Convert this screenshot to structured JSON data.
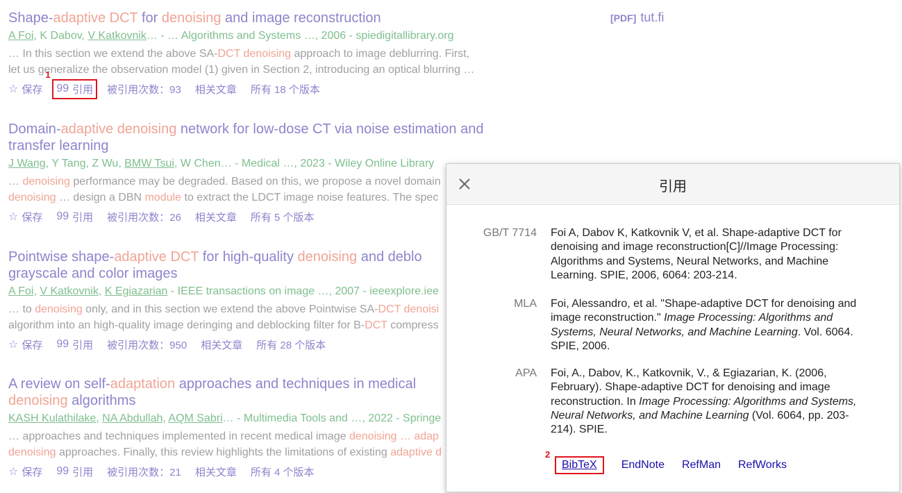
{
  "results": [
    {
      "title_parts": [
        [
          "Shape-",
          false
        ],
        [
          "adaptive DCT",
          true
        ],
        [
          " for ",
          false
        ],
        [
          "denoising",
          true
        ],
        [
          " and image reconstruction",
          false
        ]
      ],
      "authors": [
        [
          "A Foi",
          true
        ],
        [
          ", ",
          false
        ],
        [
          "K Dabov",
          false
        ],
        [
          ", ",
          false
        ],
        [
          "V Katkovnik",
          true
        ],
        [
          "… - … Algorithms and Systems …, 2006 - spiedigitallibrary.org",
          false
        ]
      ],
      "snippet_lines": [
        [
          [
            "… In this section we extend the above SA-",
            false
          ],
          [
            "DCT denoising",
            true
          ],
          [
            " approach to image deblurring. First,",
            false
          ]
        ],
        [
          [
            "let us generalize the observation model (1) given in Section 2, introducing an optical blurring …",
            false
          ]
        ]
      ],
      "actions": {
        "save": "保存",
        "cite": "引用",
        "cited_by": "被引用次数：93",
        "related": "相关文章",
        "versions": "所有 18 个版本"
      }
    },
    {
      "title_parts": [
        [
          "Domain‐",
          false
        ],
        [
          "adaptive denoising",
          true
        ],
        [
          " network for low‐dose CT via noise estimation and",
          false
        ]
      ],
      "title_line2": [
        [
          "transfer learning",
          false
        ]
      ],
      "authors": [
        [
          "J Wang",
          true
        ],
        [
          ", ",
          false
        ],
        [
          "Y Tang",
          false
        ],
        [
          ", ",
          false
        ],
        [
          "Z Wu",
          false
        ],
        [
          ", ",
          false
        ],
        [
          "BMW Tsui",
          true
        ],
        [
          ", ",
          false
        ],
        [
          "W Chen",
          false
        ],
        [
          "… - Medical …, 2023 - Wiley Online Library",
          false
        ]
      ],
      "snippet_lines": [
        [
          [
            "… ",
            false
          ],
          [
            "denoising",
            true
          ],
          [
            " performance may be degraded. Based on this, we propose a novel domain",
            false
          ]
        ],
        [
          [
            "denoising",
            true
          ],
          [
            " … design a DBN ",
            false
          ],
          [
            "module",
            true
          ],
          [
            " to extract the LDCT image noise features. The spec",
            false
          ]
        ]
      ],
      "actions": {
        "save": "保存",
        "cite": "引用",
        "cited_by": "被引用次数：26",
        "related": "相关文章",
        "versions": "所有 5 个版本"
      }
    },
    {
      "title_parts": [
        [
          "Pointwise shape-",
          false
        ],
        [
          "adaptive DCT",
          true
        ],
        [
          " for high-quality ",
          false
        ],
        [
          "denoising",
          true
        ],
        [
          " and deblo",
          false
        ]
      ],
      "title_line2": [
        [
          "grayscale and color images",
          false
        ]
      ],
      "authors": [
        [
          "A Foi",
          true
        ],
        [
          ", ",
          false
        ],
        [
          "V Katkovnik",
          true
        ],
        [
          ", ",
          false
        ],
        [
          "K Egiazarian",
          true
        ],
        [
          " - IEEE transactions on image …, 2007 - ieeexplore.iee",
          false
        ]
      ],
      "snippet_lines": [
        [
          [
            "… to ",
            false
          ],
          [
            "denoising",
            true
          ],
          [
            " only, and in this section we extend the above Pointwise SA-",
            false
          ],
          [
            "DCT denoisi",
            true
          ]
        ],
        [
          [
            "algorithm into an high-quality image deringing and deblocking filter for B-",
            false
          ],
          [
            "DCT",
            true
          ],
          [
            " compress",
            false
          ]
        ]
      ],
      "actions": {
        "save": "保存",
        "cite": "引用",
        "cited_by": "被引用次数：950",
        "related": "相关文章",
        "versions": "所有 28 个版本"
      }
    },
    {
      "title_parts": [
        [
          "A review on self-",
          false
        ],
        [
          "adaptation",
          true
        ],
        [
          " approaches and techniques in medical",
          false
        ]
      ],
      "title_line2": [
        [
          "denoising",
          true
        ],
        [
          " algorithms",
          false
        ]
      ],
      "authors": [
        [
          "KASH Kulathilake",
          true
        ],
        [
          ", ",
          false
        ],
        [
          "NA Abdullah",
          true
        ],
        [
          ", ",
          false
        ],
        [
          "AQM Sabri",
          true
        ],
        [
          "… - Multimedia Tools and …, 2022 - Springe",
          false
        ]
      ],
      "snippet_lines": [
        [
          [
            "… approaches and techniques implemented in recent medical image ",
            false
          ],
          [
            "denoising",
            true
          ],
          [
            " … adap",
            true
          ]
        ],
        [
          [
            "denoising",
            true
          ],
          [
            " approaches. Finally, this review highlights the limitations of existing ",
            false
          ],
          [
            "adaptive d",
            true
          ]
        ]
      ],
      "actions": {
        "save": "保存",
        "cite": "引用",
        "cited_by": "被引用次数：21",
        "related": "相关文章",
        "versions": "所有 4 个版本"
      }
    }
  ],
  "pdf": {
    "tag": "[PDF]",
    "site": "tut.fi"
  },
  "markers": {
    "step1": "1",
    "step2": "2"
  },
  "modal": {
    "title": "引用",
    "citations": [
      {
        "label": "GB/T 7714",
        "parts": [
          [
            "Foi A, Dabov K, Katkovnik V, et al. Shape-adaptive DCT for denoising and image reconstruction[C]//Image Processing: Algorithms and Systems, Neural Networks, and Machine Learning. SPIE, 2006, 6064: 203-214.",
            false
          ]
        ]
      },
      {
        "label": "MLA",
        "parts": [
          [
            "Foi, Alessandro, et al. \"Shape-adaptive DCT for denoising and image reconstruction.\" ",
            false
          ],
          [
            "Image Processing: Algorithms and Systems, Neural Networks, and Machine Learning",
            true
          ],
          [
            ". Vol. 6064. SPIE, 2006.",
            false
          ]
        ]
      },
      {
        "label": "APA",
        "parts": [
          [
            "Foi, A., Dabov, K., Katkovnik, V., & Egiazarian, K. (2006, February). Shape-adaptive DCT for denoising and image reconstruction. In ",
            false
          ],
          [
            "Image Processing: Algorithms and Systems, Neural Networks, and Machine Learning",
            true
          ],
          [
            " (Vol. 6064, pp. 203-214). SPIE.",
            false
          ]
        ]
      }
    ],
    "exports": [
      "BibTeX",
      "EndNote",
      "RefMan",
      "RefWorks"
    ]
  }
}
